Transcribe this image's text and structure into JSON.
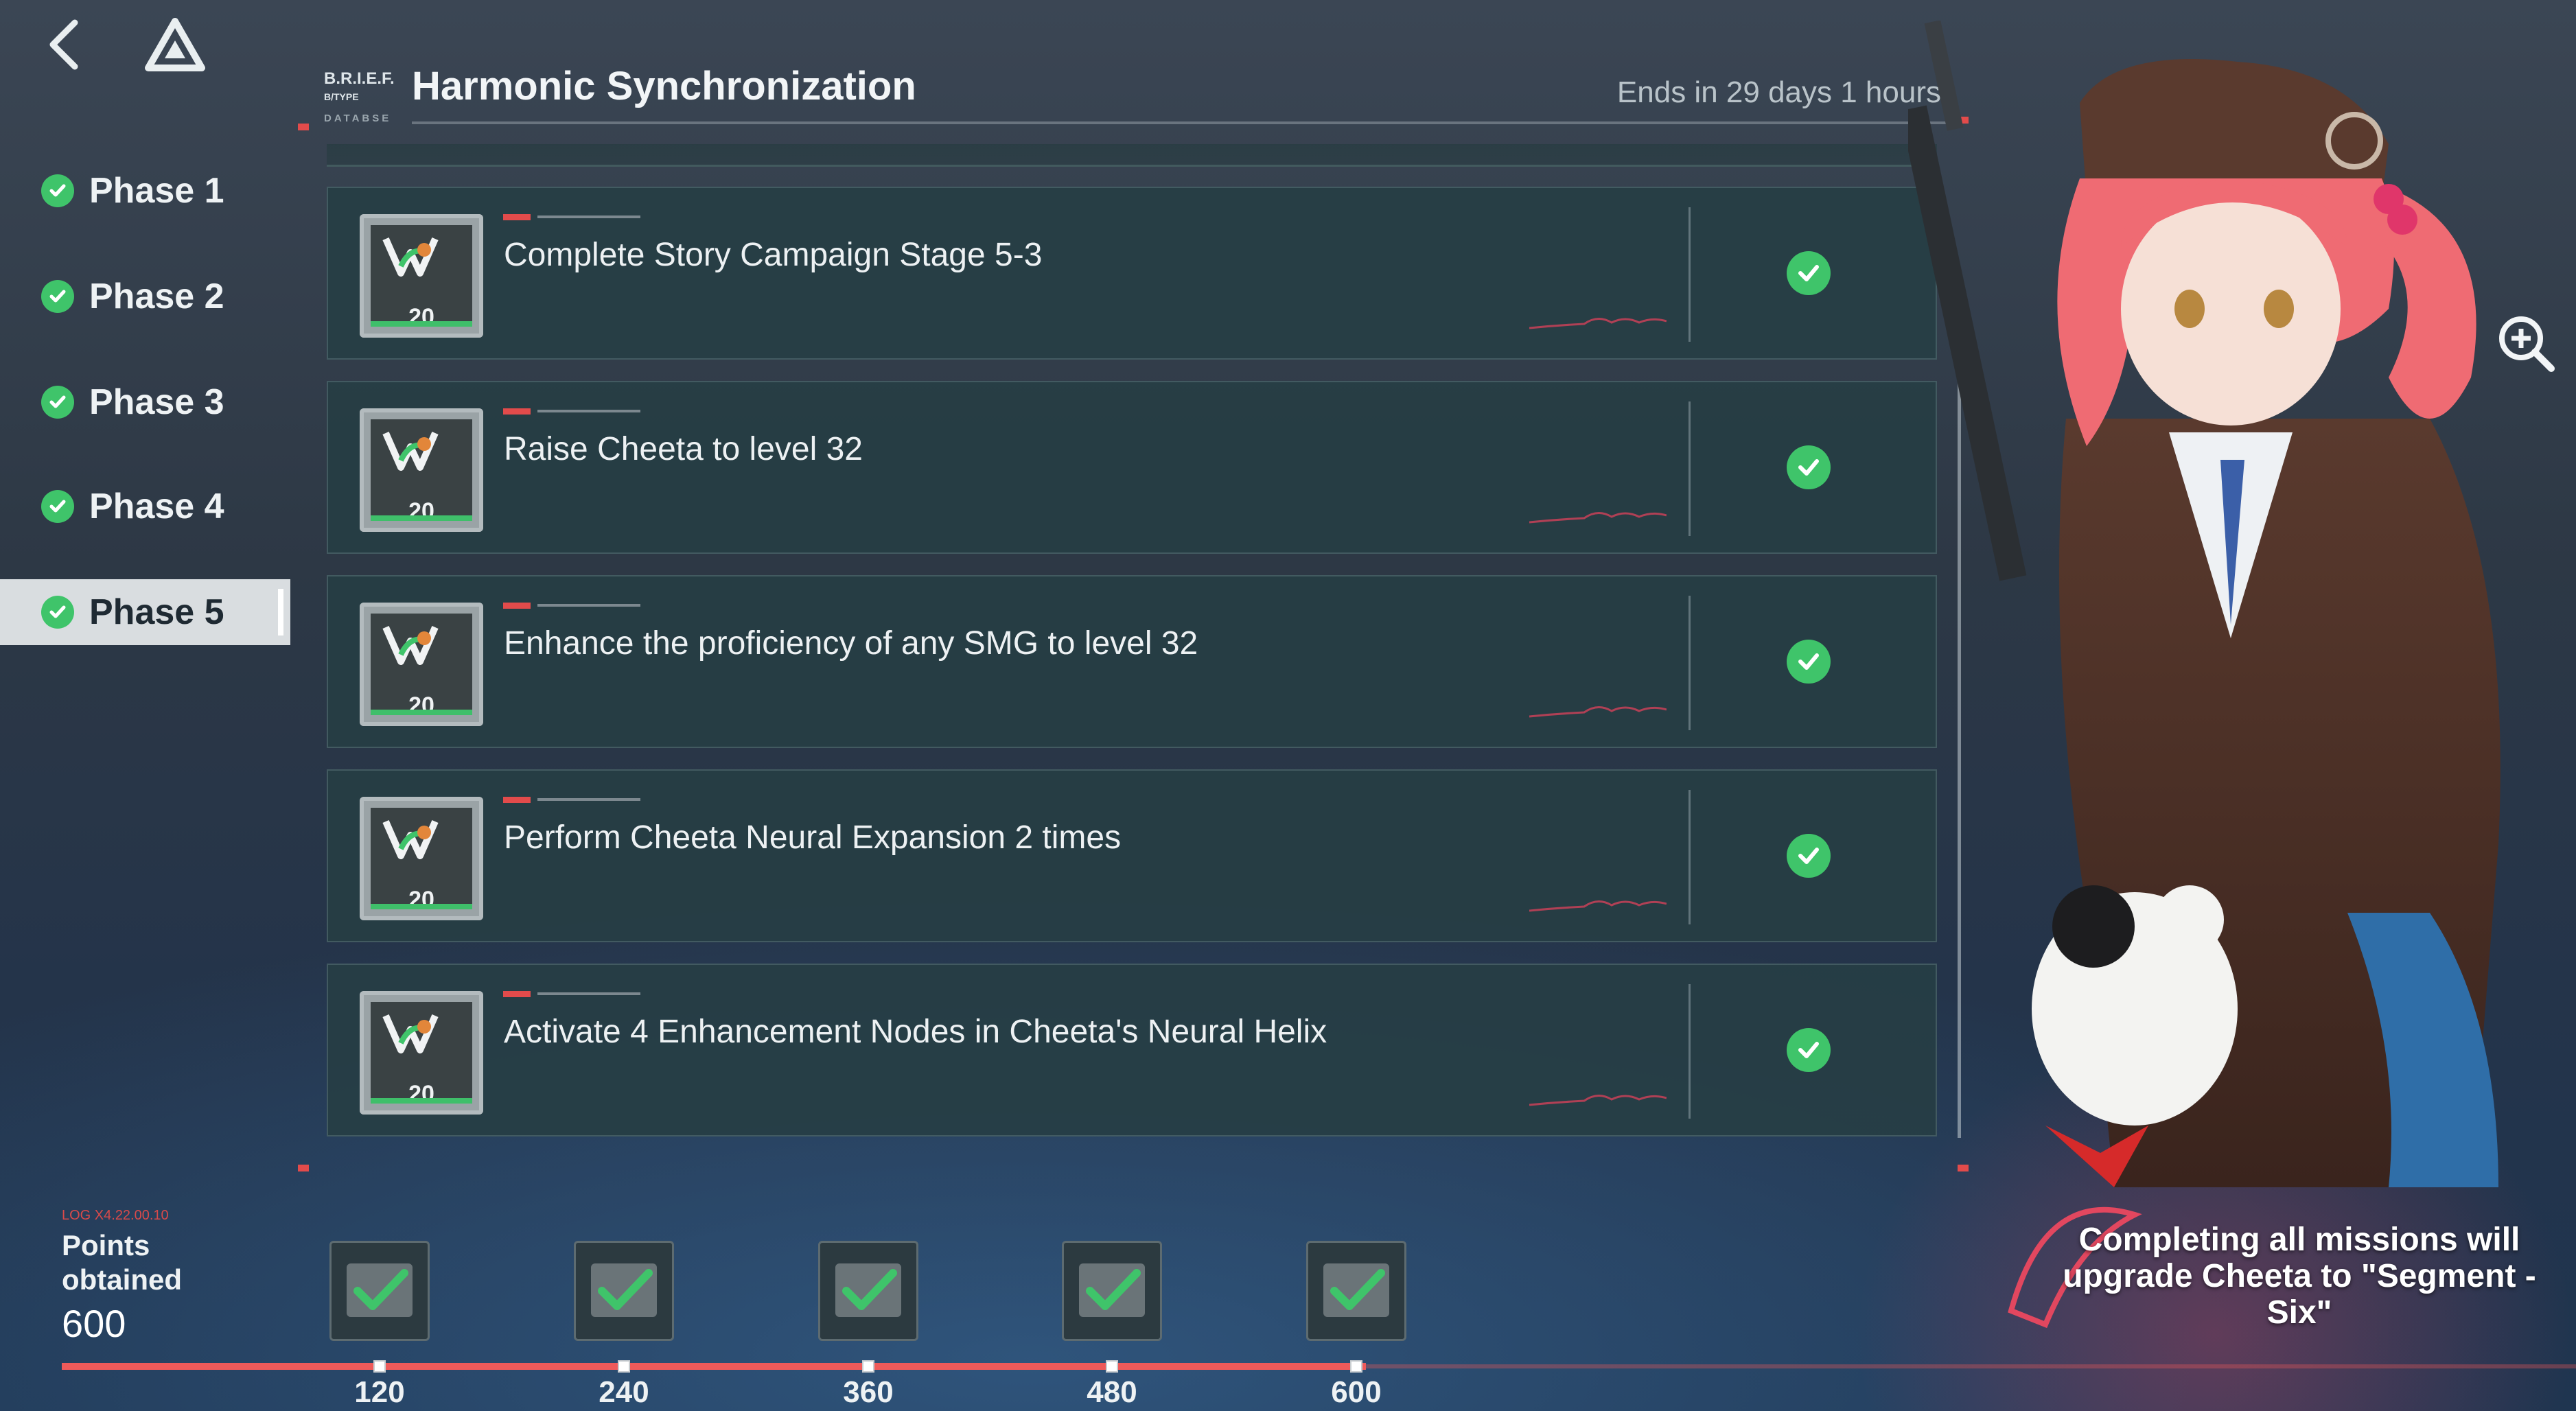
{
  "header": {
    "brief": "B.R.I.E.F.",
    "brief_sub": "B/TYPE",
    "brief_db": "DATABSE",
    "title": "Harmonic Synchronization",
    "ends": "Ends in 29 days 1 hours"
  },
  "phases": [
    {
      "label": "Phase 1",
      "completed": true
    },
    {
      "label": "Phase 2",
      "completed": true
    },
    {
      "label": "Phase 3",
      "completed": true
    },
    {
      "label": "Phase 4",
      "completed": true
    },
    {
      "label": "Phase 5",
      "completed": true,
      "selected": true
    }
  ],
  "missions": [
    {
      "text": "Complete Story Campaign Stage 5-3",
      "reward": "20",
      "completed": true
    },
    {
      "text": "Raise Cheeta to level 32",
      "reward": "20",
      "completed": true
    },
    {
      "text": "Enhance the proficiency of any SMG to level 32",
      "reward": "20",
      "completed": true
    },
    {
      "text": "Perform Cheeta Neural Expansion 2 times",
      "reward": "20",
      "completed": true
    },
    {
      "text": "Activate 4 Enhancement Nodes in Cheeta's Neural Helix",
      "reward": "20",
      "completed": true
    }
  ],
  "points": {
    "log": "LOG X4.22.00.10",
    "label_line1": "Points",
    "label_line2": "obtained",
    "value": "600"
  },
  "rewards": [
    {
      "threshold": "120",
      "claimed": true
    },
    {
      "threshold": "240",
      "claimed": true
    },
    {
      "threshold": "360",
      "claimed": true
    },
    {
      "threshold": "480",
      "claimed": true
    },
    {
      "threshold": "600",
      "claimed": true
    }
  ],
  "footer": {
    "upgrade_text": "Completing all missions will upgrade Cheeta to \"Segment - Six\""
  },
  "colors": {
    "accent_red": "#e24b4b",
    "check_green": "#3fc46a",
    "panel": "#263e44"
  },
  "icons": [
    "back-icon",
    "home-logo-icon",
    "check-icon",
    "zoom-in-icon",
    "chest-icon"
  ]
}
